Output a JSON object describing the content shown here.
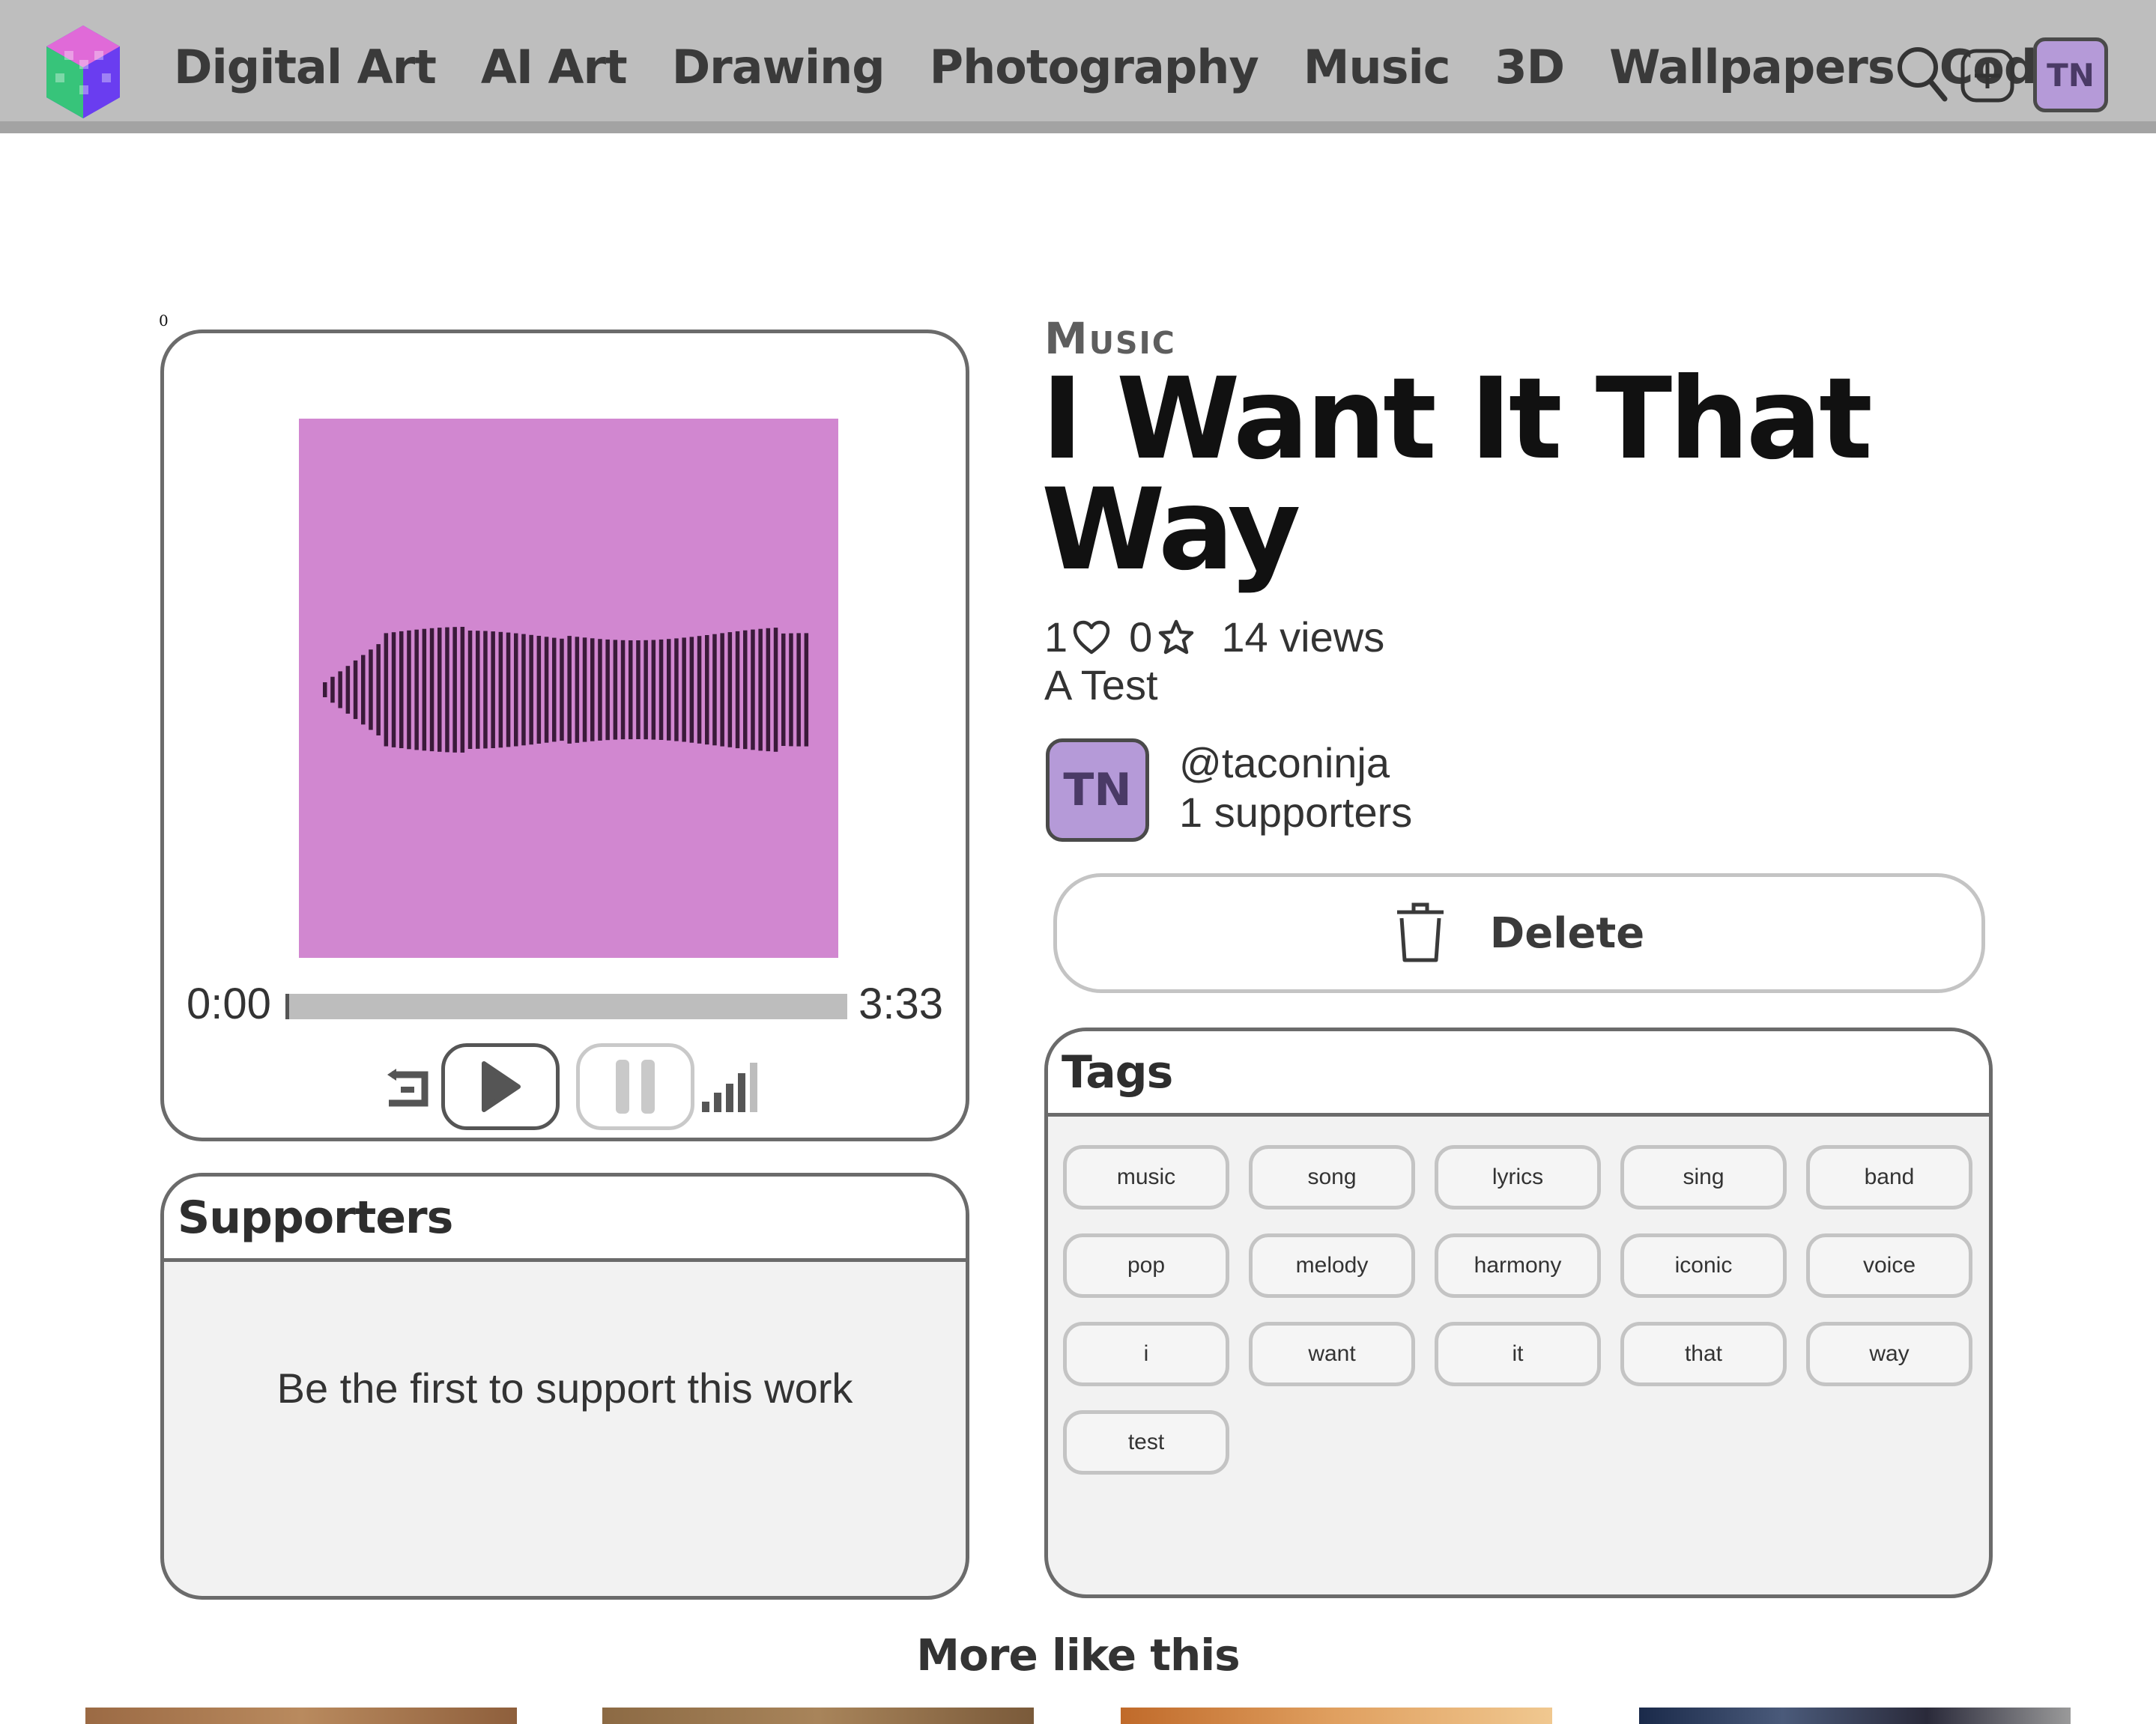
{
  "nav": {
    "links": [
      "Digital Art",
      "AI Art",
      "Drawing",
      "Photography",
      "Music",
      "3D",
      "Wallpapers",
      "Code"
    ],
    "user_initials": "TN"
  },
  "player": {
    "index_label": "0",
    "time_current": "0:00",
    "time_total": "3:33",
    "progress": 0,
    "cover_color": "#d187d0"
  },
  "post": {
    "category": "Music",
    "title": "I Want It That Way",
    "likes": "1",
    "favorites": "0",
    "views": "14 views",
    "description": "A Test"
  },
  "author": {
    "initials": "TN",
    "handle": "@taconinja",
    "supporters": "1 supporters"
  },
  "actions": {
    "delete_label": "Delete"
  },
  "supporters_panel": {
    "title": "Supporters",
    "empty_text": "Be the first to support this work"
  },
  "tags_panel": {
    "title": "Tags",
    "tags": [
      "music",
      "song",
      "lyrics",
      "sing",
      "band",
      "pop",
      "melody",
      "harmony",
      "iconic",
      "voice",
      "i",
      "want",
      "it",
      "that",
      "way",
      "test"
    ]
  },
  "more": {
    "title": "More like this"
  },
  "colors": {
    "nav_bg": "#bebebe",
    "avatar": "#b59ad8",
    "cover": "#d187d0",
    "waveform": "#3a1a3a"
  }
}
